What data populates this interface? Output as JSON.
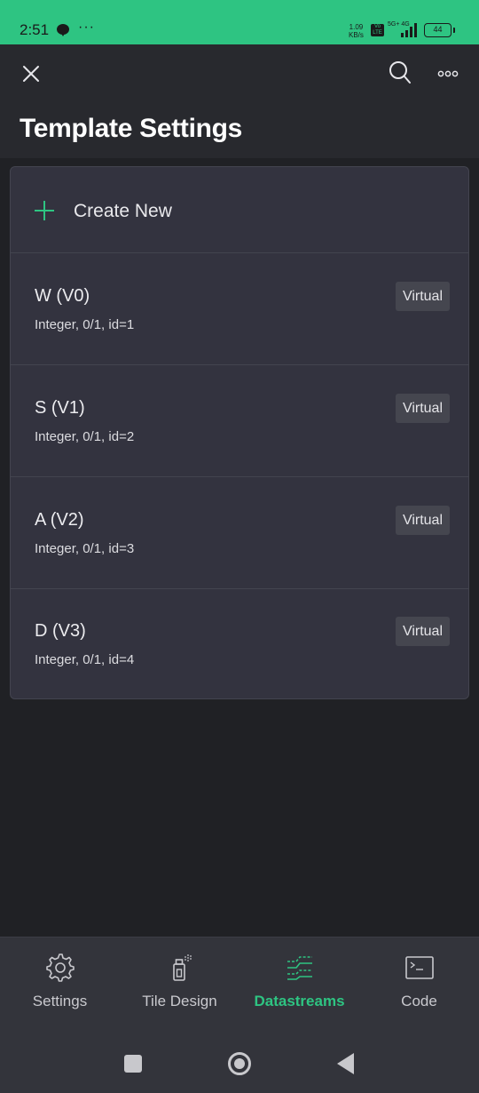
{
  "status_bar": {
    "time": "2:51",
    "more": "···",
    "speed_value": "1.09",
    "speed_unit": "KB/s",
    "volte": "Vo LTE",
    "network": "5G+ 4G",
    "battery": "44"
  },
  "header": {
    "title": "Template Settings",
    "close_icon": "close-icon",
    "search_icon": "search-icon",
    "more_icon": "more-icon"
  },
  "list": {
    "create_label": "Create New",
    "items": [
      {
        "name": "W (V0)",
        "desc": "Integer, 0/1, id=1",
        "badge": "Virtual"
      },
      {
        "name": "S (V1)",
        "desc": "Integer, 0/1, id=2",
        "badge": "Virtual"
      },
      {
        "name": "A (V2)",
        "desc": "Integer, 0/1, id=3",
        "badge": "Virtual"
      },
      {
        "name": "D (V3)",
        "desc": "Integer, 0/1, id=4",
        "badge": "Virtual"
      }
    ]
  },
  "bottom_nav": {
    "items": [
      {
        "label": "Settings",
        "icon": "gear-icon",
        "active": false
      },
      {
        "label": "Tile Design",
        "icon": "spray-icon",
        "active": false
      },
      {
        "label": "Datastreams",
        "icon": "datastreams-icon",
        "active": true
      },
      {
        "label": "Code",
        "icon": "terminal-icon",
        "active": false
      }
    ]
  },
  "colors": {
    "accent": "#2ec482",
    "background": "#202125",
    "card": "#33333f",
    "header": "#28292e"
  }
}
